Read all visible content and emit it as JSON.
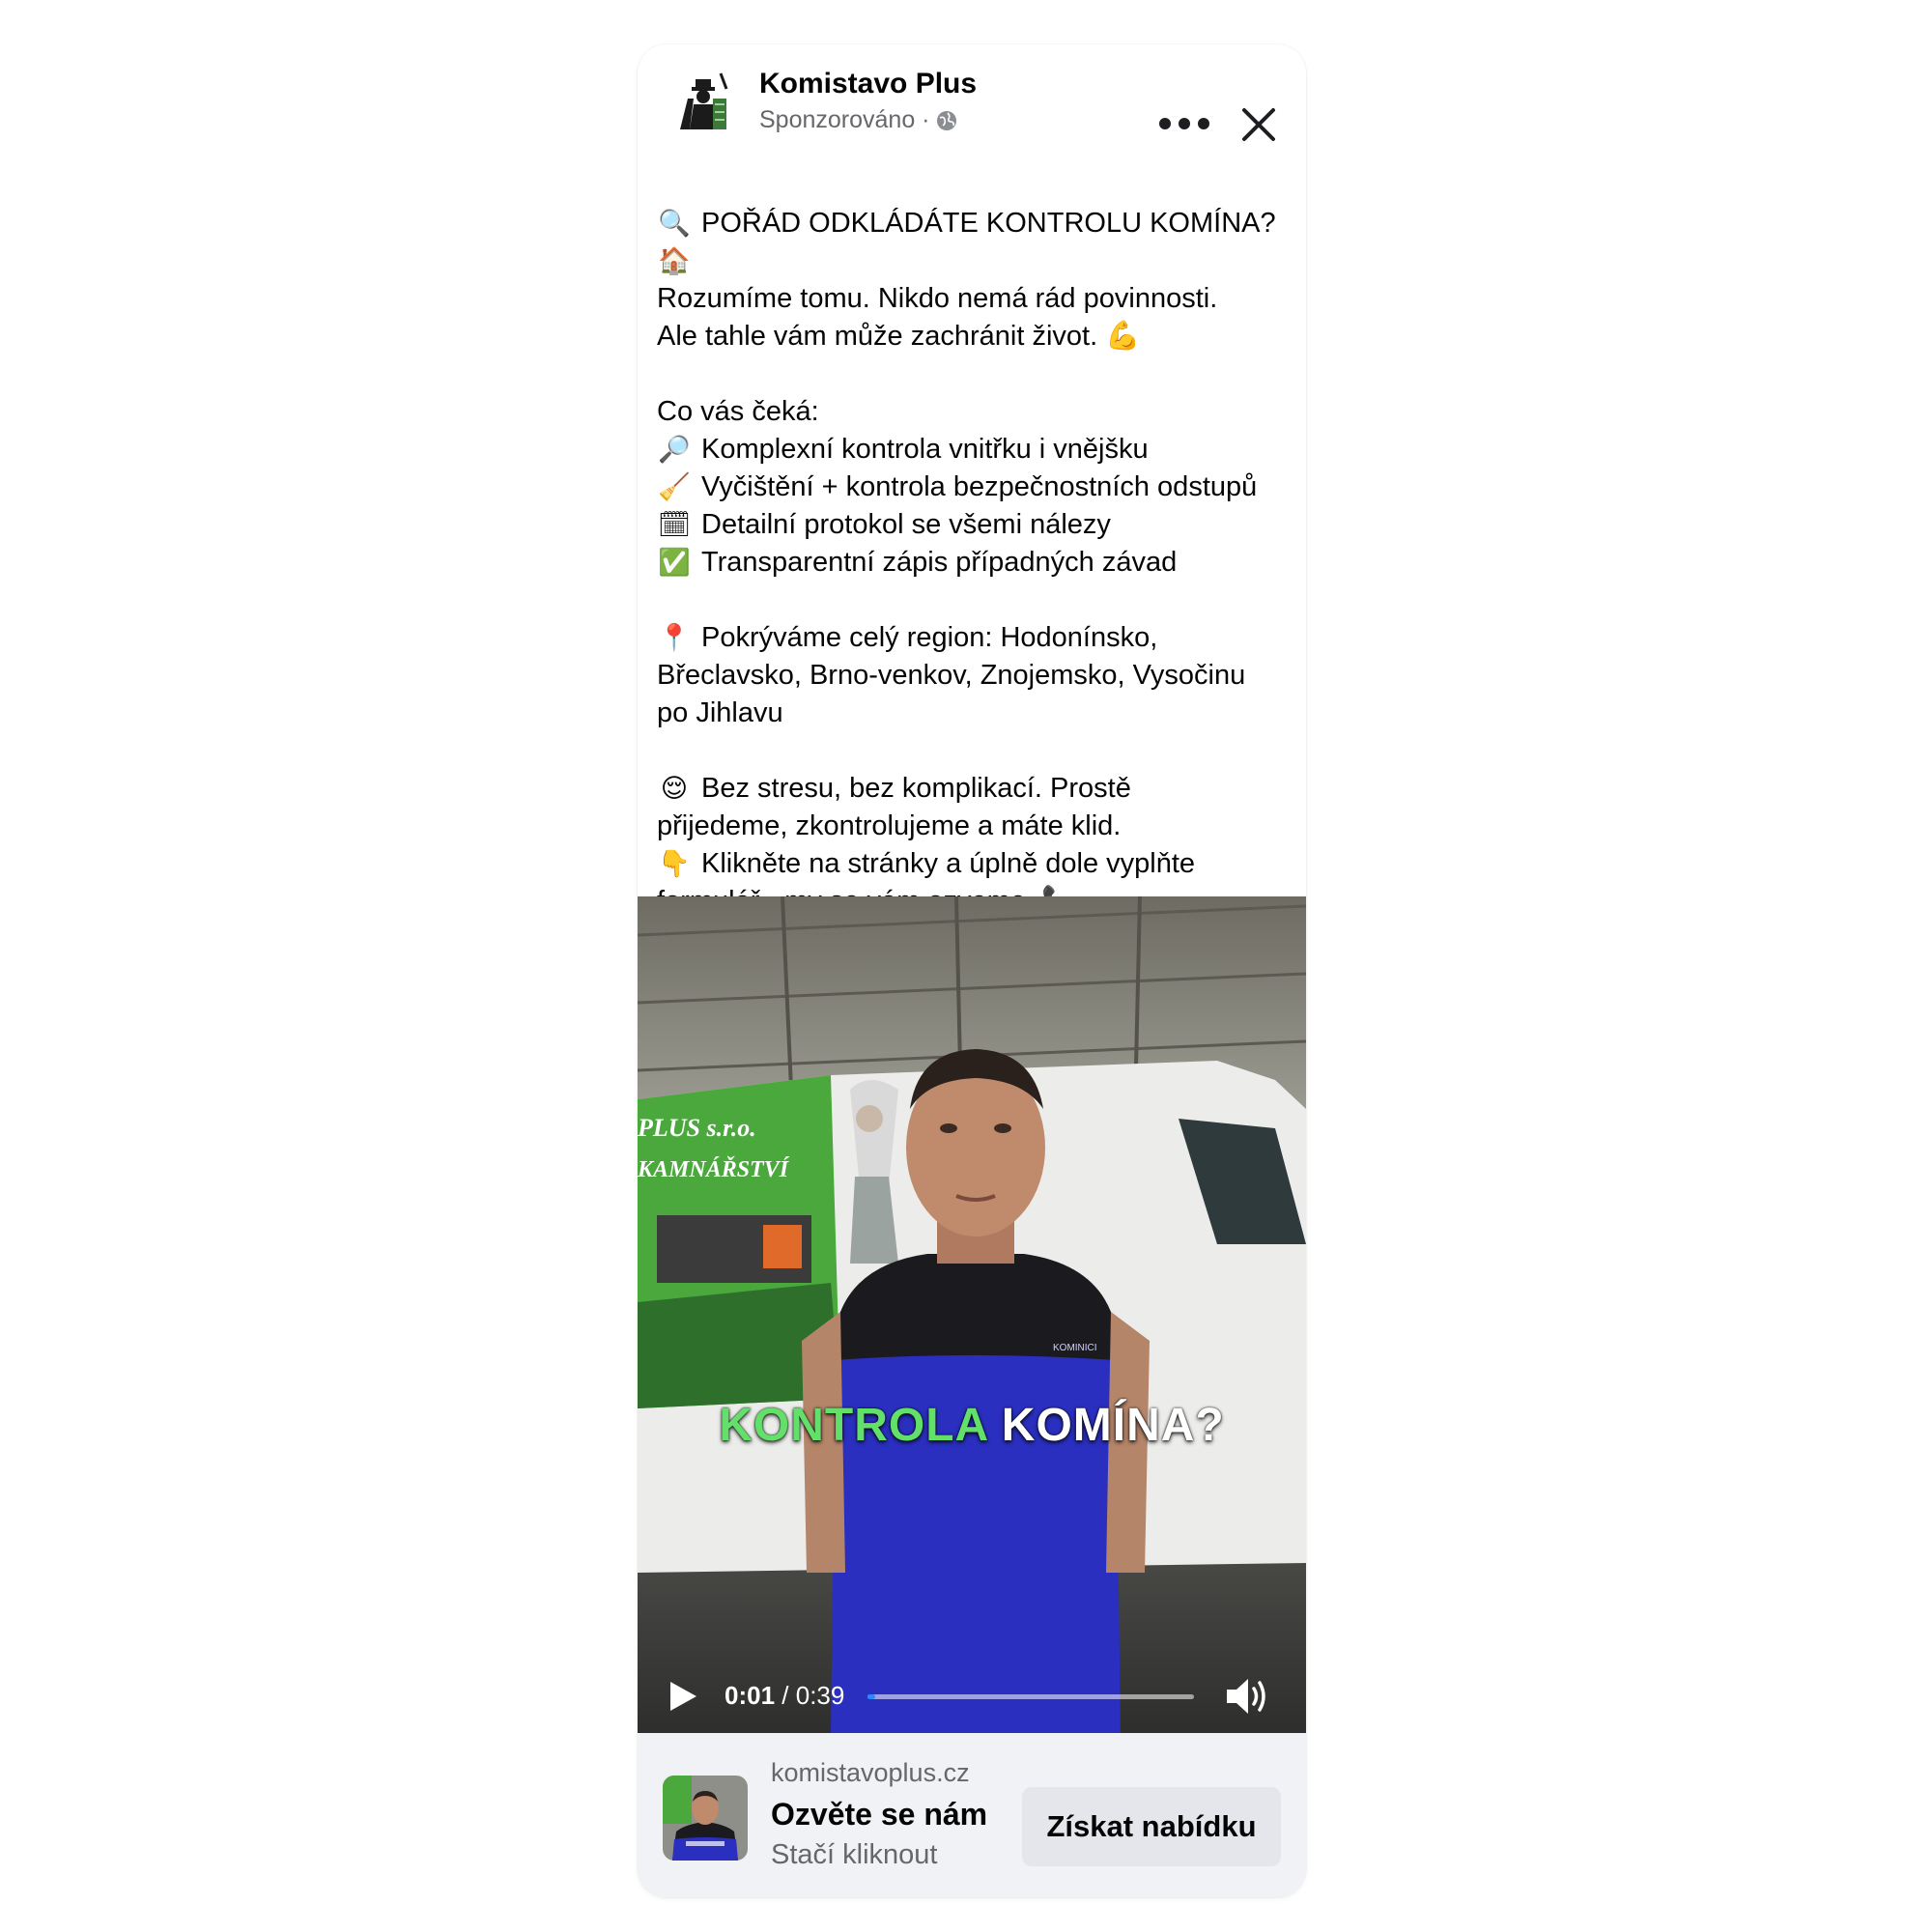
{
  "post": {
    "page_name": "Komistavo Plus",
    "sponsored": "Sponzorováno ·",
    "avatar_icon": "chimney-sweep-logo-icon",
    "lines": [
      {
        "emoji": "🔍",
        "text": "POŘÁD ODKLÁDÁTE KONTROLU KOMÍNA?"
      },
      {
        "emoji": "🏠",
        "text": ""
      },
      {
        "emoji": "",
        "text": "Rozumíme tomu. Nikdo nemá rád povinnosti."
      },
      {
        "emoji": "",
        "text": "Ale tahle vám může zachránit život. 💪"
      },
      {
        "emoji": "",
        "text": ""
      },
      {
        "emoji": "",
        "text": "Co vás čeká:"
      },
      {
        "emoji": "🔎",
        "text": "Komplexní kontrola vnitřku i vnějšku"
      },
      {
        "emoji": "🧹",
        "text": "Vyčištění + kontrola bezpečnostních odstupů"
      },
      {
        "emoji": "🗓",
        "text": "Detailní protokol se všemi nálezy"
      },
      {
        "emoji": "✅",
        "text": "Transparentní zápis případných závad"
      },
      {
        "emoji": "",
        "text": ""
      },
      {
        "emoji": "📍",
        "text": "Pokrýváme celý region: Hodonínsko,"
      },
      {
        "emoji": "",
        "text": "Břeclavsko, Brno-venkov, Znojemsko, Vysočinu"
      },
      {
        "emoji": "",
        "text": "po Jihlavu"
      },
      {
        "emoji": "",
        "text": ""
      },
      {
        "emoji": "😌",
        "text": "Bez stresu, bez komplikací. Prostě"
      },
      {
        "emoji": "",
        "text": "přijedeme, zkontrolujeme a máte klid."
      },
      {
        "emoji": "👇",
        "text": "Klikněte na stránky a úplně dole vyplňte"
      },
      {
        "emoji": "",
        "text": "formulář - my se vám ozveme. 📞"
      }
    ]
  },
  "video": {
    "subtitle_green": "KONTROLA",
    "subtitle_white": "KOMÍNA?",
    "van_text_1": "PLUS s.r.o.",
    "van_text_2": "KAMNÁŘSTVÍ",
    "current_time": "0:01",
    "duration": "/ 0:39",
    "progress": 0.025,
    "play_icon": "play-icon",
    "volume_icon": "volume-icon",
    "accent_color": "#2d88ff"
  },
  "cta": {
    "domain": "komistavoplus.cz",
    "headline": "Ozvěte se nám",
    "description": "Stačí kliknout",
    "button_label": "Získat nabídku"
  },
  "colors": {
    "text_primary": "#050505",
    "text_secondary": "#65676b",
    "subtitle_green": "#62e06a",
    "shirt_blue": "#2a2fbf"
  }
}
